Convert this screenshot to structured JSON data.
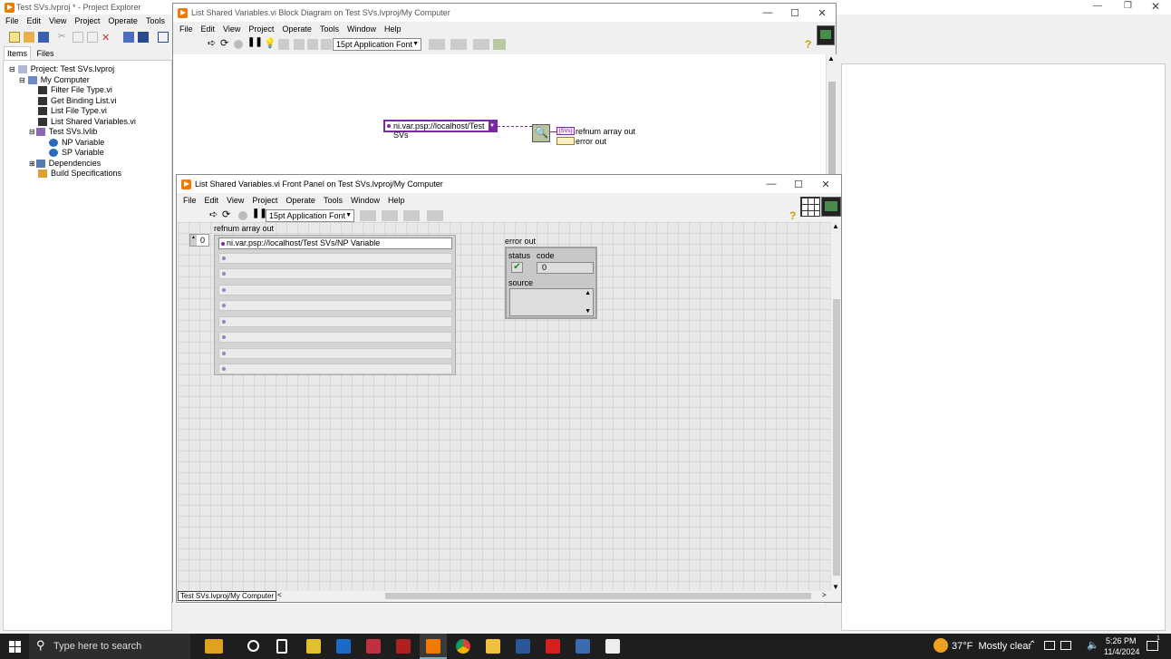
{
  "project_explorer": {
    "title": "Test SVs.lvproj * - Project Explorer",
    "menu": [
      "File",
      "Edit",
      "View",
      "Project",
      "Operate",
      "Tools",
      "Wi"
    ],
    "tabs": [
      "Items",
      "Files"
    ],
    "tree": [
      {
        "label": "Project: Test SVs.lvproj"
      },
      {
        "label": "My Computer"
      },
      {
        "label": "Filter File Type.vi"
      },
      {
        "label": "Get Binding List.vi"
      },
      {
        "label": "List File Type.vi"
      },
      {
        "label": "List Shared Variables.vi"
      },
      {
        "label": "Test SVs.lvlib"
      },
      {
        "label": "NP Variable"
      },
      {
        "label": "SP Variable"
      },
      {
        "label": "Dependencies"
      },
      {
        "label": "Build Specifications"
      }
    ]
  },
  "block_diagram": {
    "title": "List Shared Variables.vi Block Diagram on Test SVs.lvproj/My Computer",
    "menu": [
      "File",
      "Edit",
      "View",
      "Project",
      "Operate",
      "Tools",
      "Window",
      "Help"
    ],
    "font": "15pt Application Font",
    "constant": "ni.var.psp://localhost/Test SVs",
    "vi_badge": "{SVs}",
    "labels": {
      "refnum": "refnum array out",
      "error": "error out"
    }
  },
  "front_panel": {
    "title": "List Shared Variables.vi Front Panel on Test SVs.lvproj/My Computer",
    "menu": [
      "File",
      "Edit",
      "View",
      "Project",
      "Operate",
      "Tools",
      "Window",
      "Help"
    ],
    "font": "15pt Application Font",
    "array": {
      "label": "refnum array out",
      "index": "0",
      "first_value": "ni.var.psp://localhost/Test SVs/NP Variable"
    },
    "error_cluster": {
      "label": "error out",
      "status_label": "status",
      "code_label": "code",
      "code_value": "0",
      "source_label": "source"
    },
    "status_bar": "Test SVs.lvproj/My Computer"
  },
  "taskbar": {
    "search_placeholder": "Type here to search",
    "weather": "37°F  Mostly clear",
    "time": "5:26 PM",
    "date": "11/4/2024",
    "notifications": "1"
  }
}
